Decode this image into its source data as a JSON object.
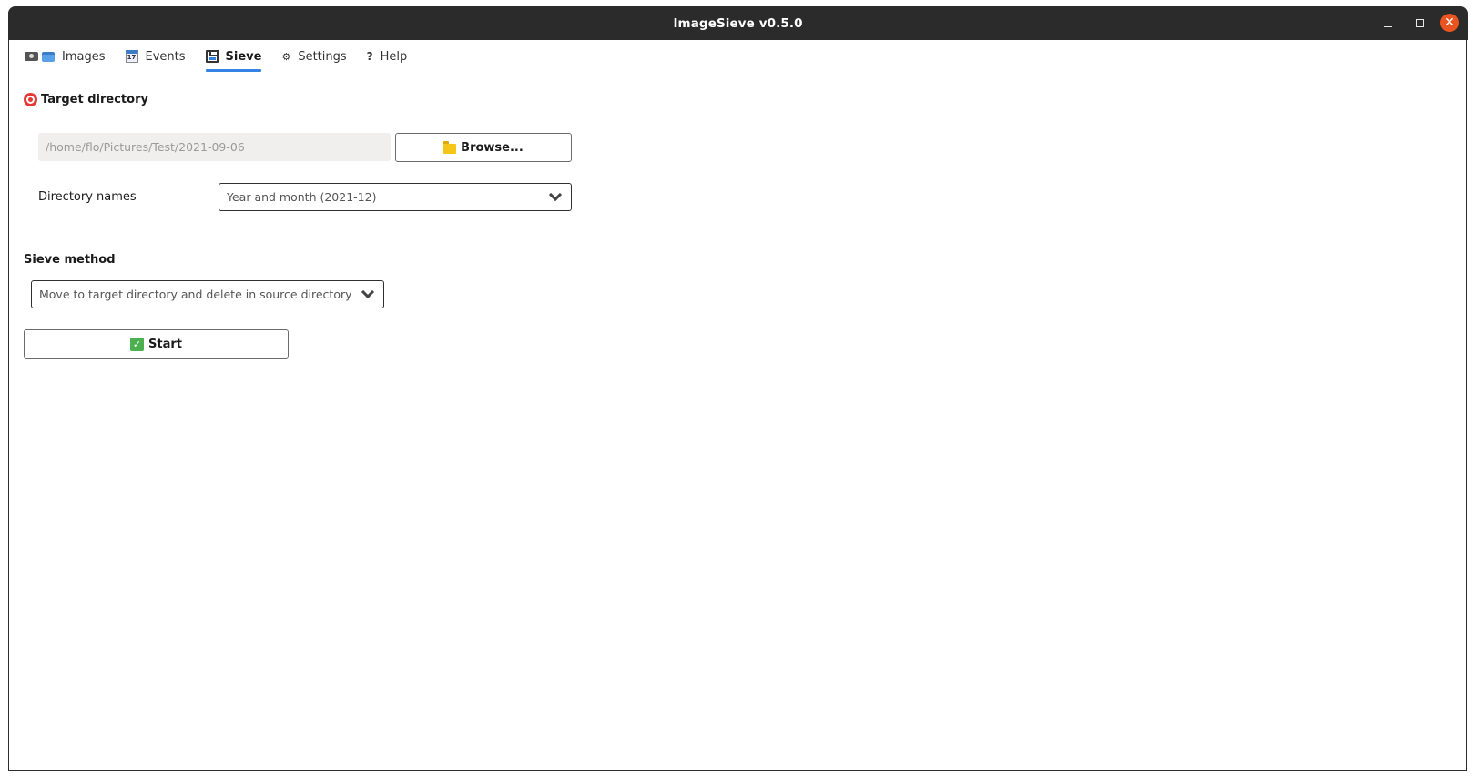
{
  "window": {
    "title": "ImageSieve v0.5.0",
    "controls": {
      "minimize": "minimize",
      "maximize": "maximize",
      "close": "✕"
    }
  },
  "tabs": [
    {
      "label": "Images",
      "icon": "camera-picture-icon",
      "active": false
    },
    {
      "label": "Events",
      "icon": "calendar-icon",
      "active": false
    },
    {
      "label": "Sieve",
      "icon": "floppy-disk-icon",
      "active": true
    },
    {
      "label": "Settings",
      "icon": "gear-icon",
      "icon_glyph": "⚙",
      "active": false
    },
    {
      "label": "Help",
      "icon": "question-icon",
      "icon_glyph": "?",
      "active": false
    }
  ],
  "calendar_icon_text": "17",
  "target_directory": {
    "title": "Target directory",
    "path_value": "/home/flo/Pictures/Test/2021-09-06",
    "browse_label": "Browse...",
    "directory_names_label": "Directory names",
    "directory_names_selected": "Year and month (2021-12)"
  },
  "sieve_method": {
    "title": "Sieve method",
    "selected": "Move to target directory and delete in source directory",
    "start_label": "Start"
  },
  "colors": {
    "accent": "#3584e4",
    "titlebar": "#2b2b2b",
    "close_button": "#e95420"
  }
}
